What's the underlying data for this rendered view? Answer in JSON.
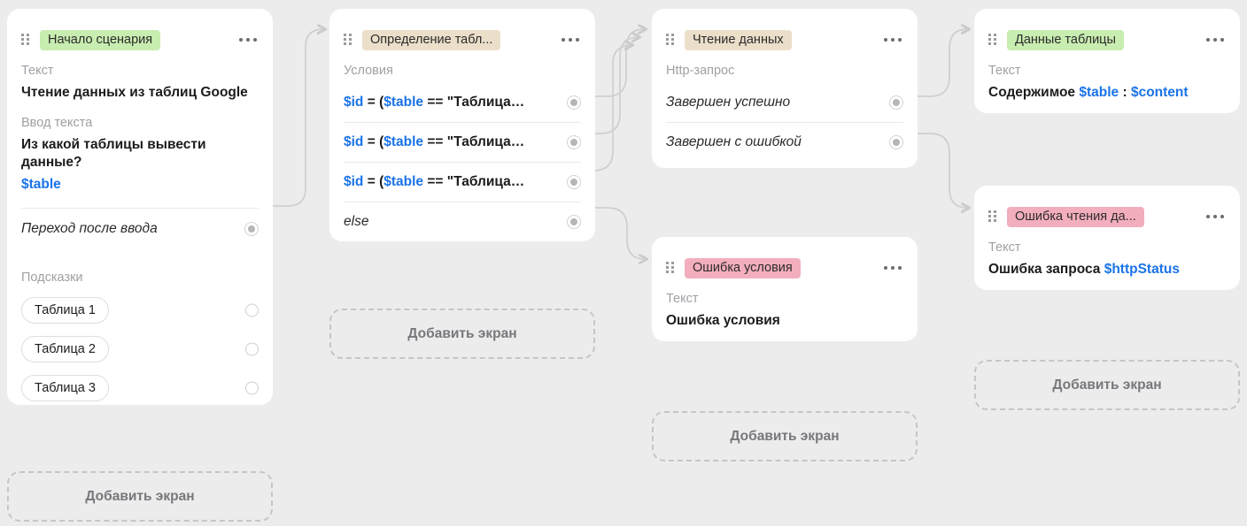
{
  "canvas": {
    "background": "#ececec"
  },
  "cards": [
    {
      "id": "start",
      "title": "Начало сценария",
      "badge_color": "green",
      "sections": [
        {
          "label": "Текст",
          "value": "Чтение данных из таблиц Google"
        },
        {
          "label": "Ввод текста",
          "value": "Из какой таблицы вывести данные?",
          "variable": "$table"
        }
      ],
      "transition_label": "Переход после ввода",
      "hints_label": "Подсказки",
      "hints": [
        "Таблица 1",
        "Таблица 2",
        "Таблица 3"
      ]
    },
    {
      "id": "condition",
      "title": "Определение табл...",
      "badge_color": "beige",
      "section_label": "Условия",
      "conditions": [
        {
          "var": "$id",
          "op": "=",
          "expr_var": "$table",
          "text": " = (",
          "tail": " == \"Таблица…"
        },
        {
          "var": "$id",
          "op": "=",
          "expr_var": "$table",
          "text": " = (",
          "tail": " == \"Таблица…"
        },
        {
          "var": "$id",
          "op": "=",
          "expr_var": "$table",
          "text": " = (",
          "tail": " == \"Таблица…"
        }
      ],
      "else_label": "else"
    },
    {
      "id": "http",
      "title": "Чтение данных",
      "badge_color": "beige",
      "section_label": "Http-запрос",
      "outcomes": [
        "Завершен успешно",
        "Завершен с ошибкой"
      ]
    },
    {
      "id": "table-data",
      "title": "Данные таблицы",
      "badge_color": "green",
      "section_label": "Текст",
      "text_prefix": "Содержимое ",
      "text_var1": "$table",
      "text_sep": " : ",
      "text_var2": "$content"
    },
    {
      "id": "read-error",
      "title": "Ошибка чтения да...",
      "badge_color": "pink",
      "section_label": "Текст",
      "text_prefix": "Ошибка запроса ",
      "text_var1": "$httpStatus"
    },
    {
      "id": "condition-error",
      "title": "Ошибка условия",
      "badge_color": "pink",
      "section_label": "Текст",
      "text_value": "Ошибка условия"
    }
  ],
  "add_screen_label": "Добавить экран",
  "colors": {
    "badge_green": "#c8edb0",
    "badge_beige": "#ecdfca",
    "badge_pink": "#f3aebd",
    "variable_blue": "#1a73e8",
    "canvas_bg": "#ececec",
    "card_bg": "#ffffff",
    "wire": "#cfcfcf"
  }
}
